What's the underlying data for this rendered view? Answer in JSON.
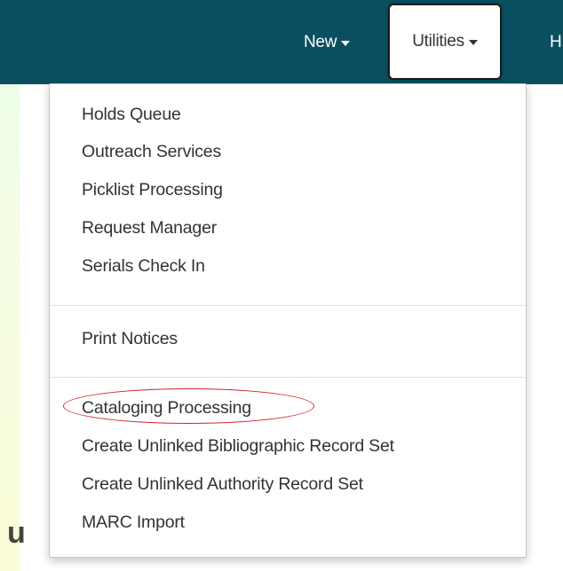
{
  "navbar": {
    "items": [
      {
        "label": "New"
      },
      {
        "label": "Utilities"
      },
      {
        "label": "H"
      }
    ]
  },
  "page": {
    "heading_fragment": "u"
  },
  "dropdown": {
    "groups": [
      {
        "items": [
          {
            "label": "Holds Queue"
          },
          {
            "label": "Outreach Services"
          },
          {
            "label": "Picklist Processing"
          },
          {
            "label": "Request Manager"
          },
          {
            "label": "Serials Check In"
          }
        ]
      },
      {
        "items": [
          {
            "label": "Print Notices"
          }
        ]
      },
      {
        "items": [
          {
            "label": "Cataloging Processing",
            "highlighted": true
          },
          {
            "label": "Create Unlinked Bibliographic Record Set"
          },
          {
            "label": "Create Unlinked Authority Record Set"
          },
          {
            "label": "MARC Import"
          }
        ]
      }
    ]
  },
  "colors": {
    "navbar_bg": "#0a4f60",
    "highlight_ring": "#d2232a",
    "menu_text": "#333333"
  }
}
